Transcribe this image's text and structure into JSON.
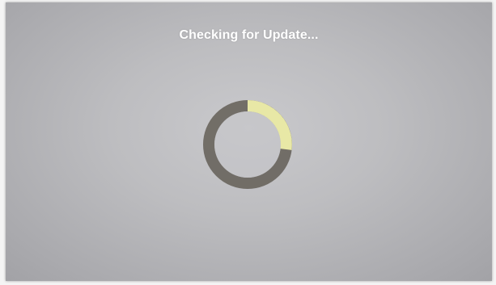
{
  "screen": {
    "status_text": "Checking for Update..."
  },
  "spinner": {
    "icon": "loading-spinner-icon",
    "track_color": "#5f5a52",
    "arc_color": "#e8e8a6"
  }
}
